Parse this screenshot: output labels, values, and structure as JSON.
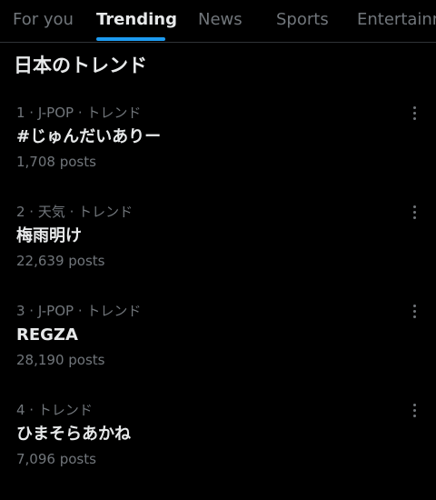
{
  "tabs": [
    {
      "label": "For you",
      "active": false
    },
    {
      "label": "Trending",
      "active": true
    },
    {
      "label": "News",
      "active": false
    },
    {
      "label": "Sports",
      "active": false
    },
    {
      "label": "Entertainment",
      "active": false
    }
  ],
  "section": {
    "title": "日本のトレンド"
  },
  "trends": [
    {
      "meta": "1 · J-POP · トレンド",
      "name": "#じゅんだいありー",
      "count": "1,708 posts"
    },
    {
      "meta": "2 · 天気 · トレンド",
      "name": "梅雨明け",
      "count": "22,639 posts"
    },
    {
      "meta": "3 · J-POP · トレンド",
      "name": "REGZA",
      "count": "28,190 posts"
    },
    {
      "meta": "4 · トレンド",
      "name": "ひまそらあかね",
      "count": "7,096 posts"
    }
  ],
  "icons": {
    "more": "more-vertical-icon"
  },
  "colors": {
    "background": "#000000",
    "primary_text": "#e7e9ea",
    "secondary_text": "#71767b",
    "accent": "#1d9bf0",
    "divider": "#2f3336"
  }
}
